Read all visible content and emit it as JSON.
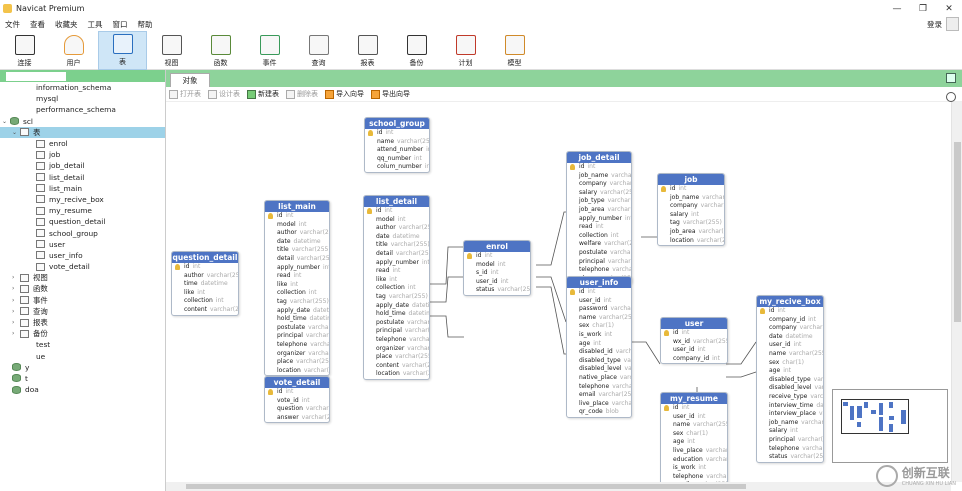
{
  "window": {
    "title": "Navicat Premium",
    "min": "—",
    "restore": "❐",
    "close": "✕"
  },
  "menu": [
    "文件",
    "查看",
    "收藏夹",
    "工具",
    "窗口",
    "帮助"
  ],
  "login": "登录",
  "toolbar": [
    {
      "label": "连接",
      "icon": "plug-icon"
    },
    {
      "label": "用户",
      "icon": "user-icon"
    },
    {
      "label": "表",
      "icon": "table-icon",
      "selected": true
    },
    {
      "label": "视图",
      "icon": "glasses-icon"
    },
    {
      "label": "函数",
      "icon": "function-icon"
    },
    {
      "label": "事件",
      "icon": "event-icon"
    },
    {
      "label": "查询",
      "icon": "query-icon"
    },
    {
      "label": "报表",
      "icon": "report-icon"
    },
    {
      "label": "备份",
      "icon": "backup-icon"
    },
    {
      "label": "计划",
      "icon": "calendar-icon"
    },
    {
      "label": "模型",
      "icon": "model-icon"
    }
  ],
  "tree": {
    "databases": [
      "information_schema",
      "mysql",
      "performance_schema"
    ],
    "db": "scl",
    "tables_label": "表",
    "tables": [
      "enrol",
      "job",
      "job_detail",
      "list_detail",
      "list_main",
      "my_recive_box",
      "my_resume",
      "question_detail",
      "school_group",
      "user",
      "user_info",
      "vote_detail"
    ],
    "groups": [
      "视图",
      "函数",
      "事件",
      "查询",
      "报表",
      "备份"
    ],
    "others": [
      "test",
      "ue",
      "y",
      "t",
      "doa"
    ]
  },
  "tab": "对象",
  "objbar": [
    "打开表",
    "设计表",
    "新建表",
    "删除表",
    "导入向导",
    "导出向导"
  ],
  "tables": [
    {
      "name": "school_group",
      "fields": [
        [
          "id",
          "int"
        ],
        [
          "name",
          "varchar(255)"
        ],
        [
          "attend_number",
          "int"
        ],
        [
          "qq_number",
          "int"
        ],
        [
          "colum_number",
          "int"
        ]
      ]
    },
    {
      "name": "list_main",
      "fields": [
        [
          "id",
          "int"
        ],
        [
          "model",
          "int"
        ],
        [
          "author",
          "varchar(255)"
        ],
        [
          "date",
          "datetime"
        ],
        [
          "title",
          "varchar(255)"
        ],
        [
          "detail",
          "varchar(255)"
        ],
        [
          "apply_number",
          "int"
        ],
        [
          "read",
          "int"
        ],
        [
          "like",
          "int"
        ],
        [
          "collection",
          "int"
        ],
        [
          "tag",
          "varchar(255)"
        ],
        [
          "apply_date",
          "datetime"
        ],
        [
          "hold_time",
          "datetime"
        ],
        [
          "postulate",
          "varchar(255)"
        ],
        [
          "principal",
          "varchar(255)"
        ],
        [
          "telephone",
          "varchar(255)"
        ],
        [
          "organizer",
          "varchar(255)"
        ],
        [
          "place",
          "varchar(255)"
        ],
        [
          "location",
          "varchar(255)"
        ]
      ]
    },
    {
      "name": "list_detail",
      "fields": [
        [
          "id",
          "int"
        ],
        [
          "model",
          "int"
        ],
        [
          "author",
          "varchar(255)"
        ],
        [
          "date",
          "datetime"
        ],
        [
          "title",
          "varchar(255)"
        ],
        [
          "detail",
          "varchar(255)"
        ],
        [
          "apply_number",
          "int"
        ],
        [
          "read",
          "int"
        ],
        [
          "like",
          "int"
        ],
        [
          "collection",
          "int"
        ],
        [
          "tag",
          "varchar(255)"
        ],
        [
          "apply_date",
          "datetime"
        ],
        [
          "hold_time",
          "datetime"
        ],
        [
          "postulate",
          "varchar(255)"
        ],
        [
          "principal",
          "varchar(255)"
        ],
        [
          "telephone",
          "varchar(255)"
        ],
        [
          "organizer",
          "varchar(255)"
        ],
        [
          "place",
          "varchar(255)"
        ],
        [
          "content",
          "varchar(255)"
        ],
        [
          "location",
          "varchar(255)"
        ]
      ]
    },
    {
      "name": "question_detail",
      "fields": [
        [
          "id",
          "int"
        ],
        [
          "author",
          "varchar(255)"
        ],
        [
          "time",
          "datetime"
        ],
        [
          "like",
          "int"
        ],
        [
          "collection",
          "int"
        ],
        [
          "content",
          "varchar(255)"
        ]
      ]
    },
    {
      "name": "vote_detail",
      "fields": [
        [
          "id",
          "int"
        ],
        [
          "vote_id",
          "int"
        ],
        [
          "question",
          "varchar(255)"
        ],
        [
          "answer",
          "varchar(255)"
        ]
      ]
    },
    {
      "name": "enrol",
      "fields": [
        [
          "id",
          "int"
        ],
        [
          "model",
          "int"
        ],
        [
          "s_id",
          "int"
        ],
        [
          "user_id",
          "int"
        ],
        [
          "status",
          "varchar(255)"
        ]
      ]
    },
    {
      "name": "job_detail",
      "fields": [
        [
          "id",
          "int"
        ],
        [
          "job_name",
          "varchar(255)"
        ],
        [
          "company",
          "varchar(255)"
        ],
        [
          "salary",
          "varchar(255)"
        ],
        [
          "job_type",
          "varchar(255)"
        ],
        [
          "job_area",
          "varchar(255)"
        ],
        [
          "apply_number",
          "int"
        ],
        [
          "read",
          "int"
        ],
        [
          "collection",
          "int"
        ],
        [
          "welfare",
          "varchar(255)"
        ],
        [
          "postulate",
          "varchar(255)"
        ],
        [
          "principal",
          "varchar(255)"
        ],
        [
          "telephone",
          "varchar(255)"
        ],
        [
          "place",
          "varchar(255)"
        ]
      ]
    },
    {
      "name": "job",
      "fields": [
        [
          "id",
          "int"
        ],
        [
          "job_name",
          "varchar(255)"
        ],
        [
          "company",
          "varchar(255)"
        ],
        [
          "salary",
          "int"
        ],
        [
          "tag",
          "varchar(255)"
        ],
        [
          "job_area",
          "varchar(255)"
        ],
        [
          "location",
          "varchar(255)"
        ]
      ]
    },
    {
      "name": "user_info",
      "fields": [
        [
          "id",
          "int"
        ],
        [
          "user_id",
          "int"
        ],
        [
          "password",
          "varchar(255)"
        ],
        [
          "name",
          "varchar(255)"
        ],
        [
          "sex",
          "char(1)"
        ],
        [
          "is_work",
          "int"
        ],
        [
          "age",
          "int"
        ],
        [
          "disabled_id",
          "varchar(255)"
        ],
        [
          "disabled_type",
          "varchar(255)"
        ],
        [
          "disabled_level",
          "varchar(255)"
        ],
        [
          "native_place",
          "varchar(255)"
        ],
        [
          "telephone",
          "varchar(255)"
        ],
        [
          "email",
          "varchar(255)"
        ],
        [
          "live_place",
          "varchar(255)"
        ],
        [
          "qr_code",
          "blob"
        ]
      ]
    },
    {
      "name": "user",
      "fields": [
        [
          "id",
          "int"
        ],
        [
          "wx_id",
          "varchar(255)"
        ],
        [
          "user_id",
          "int"
        ],
        [
          "company_id",
          "int"
        ]
      ]
    },
    {
      "name": "my_resume",
      "fields": [
        [
          "id",
          "int"
        ],
        [
          "user_id",
          "int"
        ],
        [
          "name",
          "varchar(255)"
        ],
        [
          "sex",
          "char(1)"
        ],
        [
          "age",
          "int"
        ],
        [
          "live_place",
          "varchar(255)"
        ],
        [
          "education",
          "varchar(255)"
        ],
        [
          "is_work",
          "int"
        ],
        [
          "telephone",
          "varchar(255)"
        ],
        [
          "email",
          "varchar(255)"
        ]
      ]
    },
    {
      "name": "my_recive_box",
      "fields": [
        [
          "id",
          "int"
        ],
        [
          "company_id",
          "int"
        ],
        [
          "company",
          "varchar(255)"
        ],
        [
          "date",
          "datetime"
        ],
        [
          "user_id",
          "int"
        ],
        [
          "name",
          "varchar(255)"
        ],
        [
          "sex",
          "char(1)"
        ],
        [
          "age",
          "int"
        ],
        [
          "disabled_type",
          "varchar(255)"
        ],
        [
          "disabled_level",
          "varchar(255)"
        ],
        [
          "receive_type",
          "varchar(255)"
        ],
        [
          "interview_time",
          "datetime"
        ],
        [
          "interview_place",
          "varchar(255)"
        ],
        [
          "job_name",
          "varchar(255)"
        ],
        [
          "salary",
          "int"
        ],
        [
          "principal",
          "varchar(255)"
        ],
        [
          "telephone",
          "varchar(255)"
        ],
        [
          "status",
          "varchar(255)"
        ]
      ]
    }
  ],
  "watermark": {
    "brand": "创新互联",
    "sub": "CHUANG XIN HU LIAN"
  }
}
